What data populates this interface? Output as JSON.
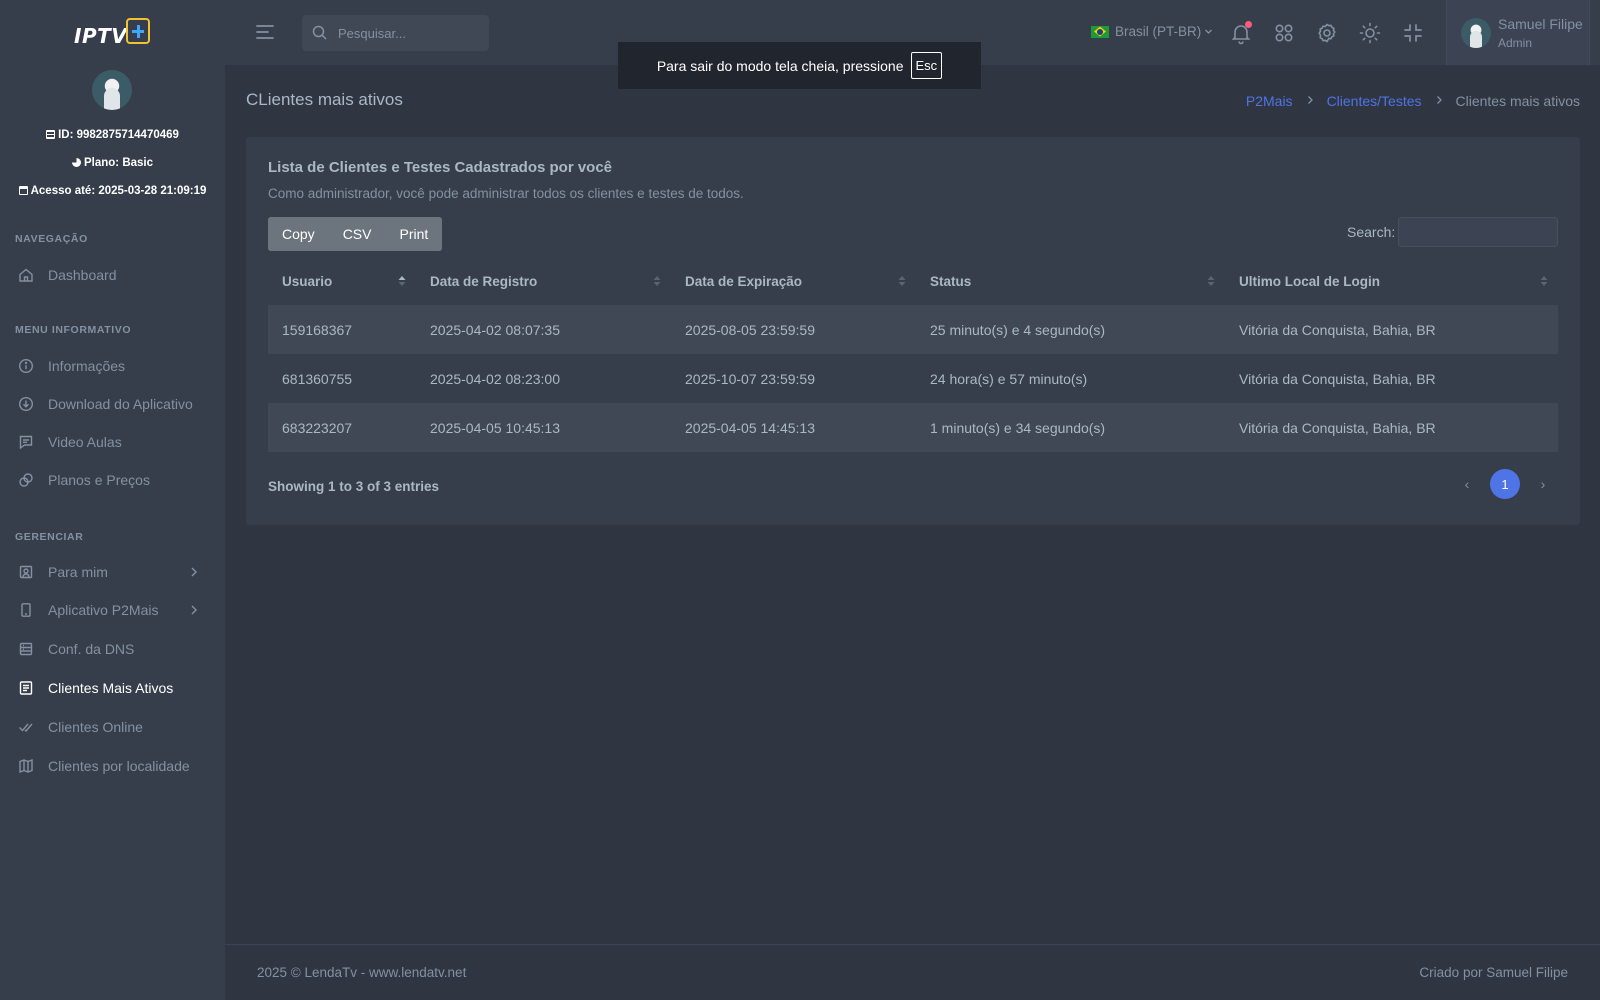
{
  "sidebar": {
    "logo_text": "IPTV",
    "user_id": "ID: 9982875714470469",
    "plan": "Plano: Basic",
    "access": "Acesso até: 2025-03-28 21:09:19",
    "sections": {
      "nav": "NAVEGAÇÃO",
      "info": "MENU INFORMATIVO",
      "manage": "GERENCIAR"
    },
    "items": {
      "dashboard": "Dashboard",
      "informacoes": "Informações",
      "download": "Download do Aplicativo",
      "video_aulas": "Video Aulas",
      "planos": "Planos e Preços",
      "para_mim": "Para mim",
      "app_p2mais": "Aplicativo P2Mais",
      "conf_dns": "Conf. da DNS",
      "clientes_ativos": "Clientes Mais Ativos",
      "clientes_online": "Clientes Online",
      "clientes_localidade": "Clientes por localidade"
    }
  },
  "topbar": {
    "search_placeholder": "Pesquisar...",
    "language": "Brasil (PT-BR)",
    "user_name": "Samuel Filipe",
    "user_role": "Admin"
  },
  "toast": {
    "message": "Para sair do modo tela cheia, pressione",
    "key": "Esc"
  },
  "page": {
    "title": "CLientes mais ativos",
    "breadcrumb": [
      "P2Mais",
      "Clientes/Testes",
      "Clientes mais ativos"
    ]
  },
  "card": {
    "title": "Lista de Clientes e Testes Cadastrados por você",
    "subtitle": "Como administrador, você pode administrar todos os clientes e testes de todos.",
    "buttons": [
      "Copy",
      "CSV",
      "Print"
    ],
    "search_label": "Search:",
    "columns": [
      "Usuario",
      "Data de Registro",
      "Data de Expiração",
      "Status",
      "Ultimo Local de Login"
    ],
    "rows": [
      [
        "159168367",
        "2025-04-02 08:07:35",
        "2025-08-05 23:59:59",
        "25 minuto(s) e 4 segundo(s)",
        "Vitória da Conquista, Bahia, BR"
      ],
      [
        "681360755",
        "2025-04-02 08:23:00",
        "2025-10-07 23:59:59",
        "24 hora(s) e 57 minuto(s)",
        "Vitória da Conquista, Bahia, BR"
      ],
      [
        "683223207",
        "2025-04-05 10:45:13",
        "2025-04-05 14:45:13",
        "1 minuto(s) e 34 segundo(s)",
        "Vitória da Conquista, Bahia, BR"
      ]
    ],
    "info": "Showing 1 to 3 of 3 entries",
    "page_number": "1",
    "prev": "‹",
    "next": "›"
  },
  "footer": {
    "left": "2025 © LendaTv - www.lendatv.net",
    "right": "Criado por Samuel Filipe"
  },
  "colors": {
    "accent": "#4f74e6",
    "sidebar_bg": "#373e4b",
    "body_bg": "#2f3541",
    "notification": "#fa5c7c"
  },
  "icons": [
    "menu-icon",
    "search-icon",
    "bell-icon",
    "apps-icon",
    "gear-icon",
    "sun-icon",
    "minimize-icon",
    "home-icon",
    "info-icon",
    "download-icon",
    "message-icon",
    "tag-icon",
    "user-square-icon",
    "phone-icon",
    "server-icon",
    "list-icon",
    "check-double-icon",
    "map-icon",
    "chevron-right-icon",
    "sort-icon"
  ]
}
